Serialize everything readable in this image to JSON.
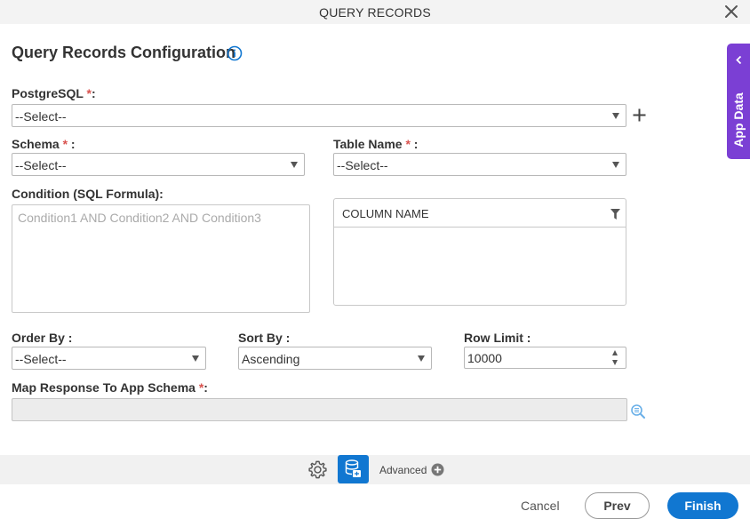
{
  "window": {
    "title": "QUERY RECORDS"
  },
  "heading": "Query Records Configuration",
  "form": {
    "postgresql": {
      "label": "PostgreSQL",
      "required": "*",
      "suffix": ":",
      "value": "--Select--"
    },
    "schema": {
      "label": "Schema",
      "required": "*",
      "suffix": " :",
      "value": "--Select--"
    },
    "table_name": {
      "label": "Table Name",
      "required": "*",
      "suffix": " :",
      "value": "--Select--"
    },
    "condition": {
      "label": "Condition (SQL Formula):",
      "placeholder": "Condition1 AND Condition2 AND Condition3"
    },
    "column_panel": {
      "header": "COLUMN NAME"
    },
    "order_by": {
      "label": "Order By :",
      "value": "--Select--"
    },
    "sort_by": {
      "label": "Sort By :",
      "value": "Ascending"
    },
    "row_limit": {
      "label": "Row Limit :",
      "value": "10000"
    },
    "map_response": {
      "label": "Map Response To App Schema",
      "required": "*",
      "suffix": ":",
      "value": ""
    }
  },
  "side_panel": {
    "label": "App Data"
  },
  "toolbar": {
    "advanced_label": "Advanced"
  },
  "buttons": {
    "cancel": "Cancel",
    "prev": "Prev",
    "finish": "Finish"
  },
  "colors": {
    "accent": "#1177d1",
    "app_data_tab": "#7b3fd4",
    "required": "#d9534f"
  }
}
